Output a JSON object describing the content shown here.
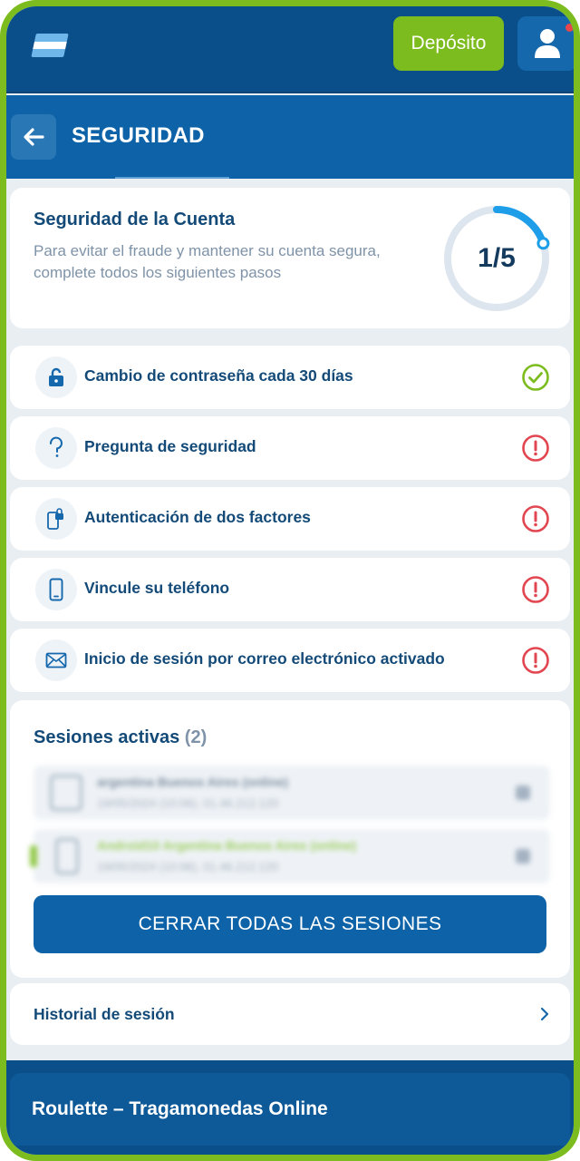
{
  "header": {
    "deposit_label": "Depósito",
    "flag_icon": "argentina-flag-icon",
    "user_icon": "user-icon",
    "colors": {
      "bar": "#0b4f8a",
      "deposit": "#7cbc1e",
      "notification": "#e7474c"
    }
  },
  "page": {
    "title": "SEGURIDAD",
    "back_icon": "arrow-left-icon"
  },
  "security": {
    "title": "Seguridad de la Cuenta",
    "description": "Para evitar el fraude y mantener su cuenta segura, complete todos los siguientes pasos",
    "progress_label": "1/5",
    "progress_completed": 1,
    "progress_total": 5
  },
  "steps": [
    {
      "label": "Cambio de contraseña cada 30 días",
      "icon": "lock-icon",
      "status": "completed"
    },
    {
      "label": "Pregunta de seguridad",
      "icon": "question-icon",
      "status": "warning"
    },
    {
      "label": "Autenticación de dos factores",
      "icon": "phone-lock-icon",
      "status": "warning"
    },
    {
      "label": "Vincule su teléfono",
      "icon": "phone-icon",
      "status": "warning"
    },
    {
      "label": "Inicio de sesión por correo electrónico activado",
      "icon": "envelope-icon",
      "status": "warning"
    }
  ],
  "sessions": {
    "title": "Sesiones activas",
    "count": "(2)",
    "items": [
      {
        "line1": "argentina Buenos Aires (online)",
        "line2": "19/05/2024 (10:06), 01.46.212.120"
      },
      {
        "line1": "Android10 Argentina Buenos Aires (online)",
        "line2": "19/05/2024 (10:06), 01.46.212.120"
      }
    ],
    "close_all_label": "CERRAR TODAS LAS SESIONES"
  },
  "history": {
    "label": "Historial de sesión"
  },
  "footer": {
    "text": "Roulette – Tragamonedas Online"
  }
}
